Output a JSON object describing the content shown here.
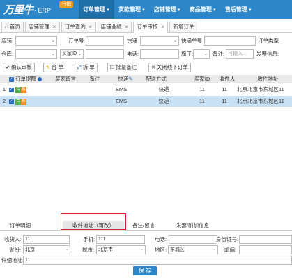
{
  "header": {
    "logo": "万里牛",
    "product": "· ERP",
    "badge": "分销",
    "nav": [
      {
        "label": "订单管理",
        "active": true
      },
      {
        "label": "货款管理",
        "active": false
      },
      {
        "label": "店铺管理",
        "active": false
      },
      {
        "label": "商品管理",
        "active": false
      },
      {
        "label": "售后管理",
        "active": false
      }
    ]
  },
  "tabs": [
    {
      "label": "首页",
      "closable": false,
      "active": false
    },
    {
      "label": "店铺管理",
      "closable": true,
      "active": false
    },
    {
      "label": "订单查询",
      "closable": true,
      "active": false
    },
    {
      "label": "店铺业绩",
      "closable": true,
      "active": false
    },
    {
      "label": "订单审核",
      "closable": true,
      "active": true
    },
    {
      "label": "新增订单",
      "closable": false,
      "active": false
    }
  ],
  "filters": {
    "row1": {
      "shop_label": "店铺:",
      "order_no_label": "订单号:",
      "express_label": "快递:",
      "express_no_label": "快递单号:",
      "order_type_label": "订单类型:"
    },
    "row2": {
      "warehouse_label": "仓库:",
      "buyer_id_value": "买家ID",
      "phone_label": "电话:",
      "flag_label": "旗子:",
      "remark_label": "备注:",
      "remark_placeholder": "可输入...",
      "invoice_label": "发票信息:"
    }
  },
  "toolbar": {
    "approve": "确认审核",
    "merge": "合 单",
    "split": "拆 单",
    "batch_remark": "批量备注",
    "close_offline": "关闭线下订单"
  },
  "grid": {
    "columns": [
      "订单提醒",
      "买家留言",
      "备注",
      "快递",
      "配送方式",
      "买家ID",
      "收件人",
      "收件地址"
    ],
    "rows": [
      {
        "no": "1",
        "tags": [
          "合",
          "拆"
        ],
        "buyer_msg": "",
        "remark": "",
        "express": "EMS",
        "delivery": "快递",
        "buyer_id": "11",
        "recipient": "11",
        "address": "北京北京市东城区11",
        "selected": false
      },
      {
        "no": "2",
        "tags": [
          "合",
          "拆"
        ],
        "buyer_msg": "",
        "remark": "",
        "express": "EMS",
        "delivery": "快递",
        "buyer_id": "11",
        "recipient": "11",
        "address": "北京北京市东城区11",
        "selected": true
      }
    ]
  },
  "detail_tabs": [
    {
      "label": "订单明细",
      "active": false
    },
    {
      "label": "收件地址（可改）",
      "active": true
    },
    {
      "label": "备注/留言",
      "active": false
    },
    {
      "label": "发票/附加信息",
      "active": false
    }
  ],
  "address_form": {
    "recipient_label": "收货人:",
    "recipient_value": "11",
    "mobile_label": "手机:",
    "mobile_value": "111",
    "phone_label": "电话:",
    "phone_value": "",
    "id_label": "身份证号:",
    "id_value": "",
    "province_label": "省份:",
    "province_value": "北京",
    "city_label": "城市:",
    "city_value": "北京市",
    "district_label": "地区:",
    "district_value": "东城区",
    "postcode_label": "邮编:",
    "postcode_value": "",
    "detail_label": "详细地址:",
    "detail_value": "11",
    "save": "保 存"
  },
  "colors": {
    "header_bg": "#2d86c8",
    "accent_orange": "#f39a1e",
    "selected_row": "#c9e1f5",
    "highlight_border": "#e02020"
  }
}
